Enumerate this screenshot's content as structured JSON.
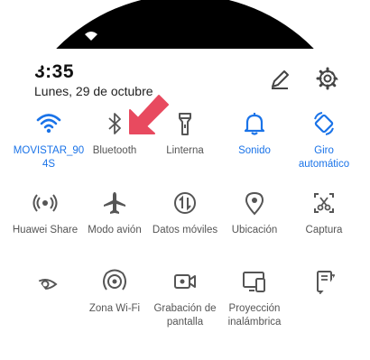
{
  "header": {
    "time": "3:35",
    "date": "Lunes, 29 de octubre"
  },
  "icons": {
    "edit": "pencil-icon",
    "settings": "gear-icon"
  },
  "colors": {
    "active": "#1a73e8",
    "inactive": "#555555",
    "arrow": "#e84a5f",
    "statusbar": "#000000"
  },
  "tiles": {
    "row1": [
      {
        "label": "MOVISTAR_90\n4S",
        "icon": "wifi-icon",
        "active": true
      },
      {
        "label": "Bluetooth",
        "icon": "bluetooth-icon",
        "active": false
      },
      {
        "label": "Linterna",
        "icon": "flashlight-icon",
        "active": false
      },
      {
        "label": "Sonido",
        "icon": "bell-icon",
        "active": true
      },
      {
        "label": "Giro\nautomático",
        "icon": "rotate-icon",
        "active": true
      }
    ],
    "row2": [
      {
        "label": "Huawei Share",
        "icon": "huawei-share-icon"
      },
      {
        "label": "Modo avión",
        "icon": "airplane-icon"
      },
      {
        "label": "Datos móviles",
        "icon": "mobile-data-icon"
      },
      {
        "label": "Ubicación",
        "icon": "location-icon"
      },
      {
        "label": "Captura",
        "icon": "screenshot-icon"
      }
    ],
    "row3": [
      {
        "label": "",
        "icon": "eye-comfort-icon"
      },
      {
        "label": "Zona Wi-Fi",
        "icon": "hotspot-icon"
      },
      {
        "label": "Grabación de\npantalla",
        "icon": "screen-record-icon"
      },
      {
        "label": "Proyección\ninalámbrica",
        "icon": "wireless-projection-icon"
      },
      {
        "label": "",
        "icon": "ebook-mode-icon"
      }
    ]
  }
}
